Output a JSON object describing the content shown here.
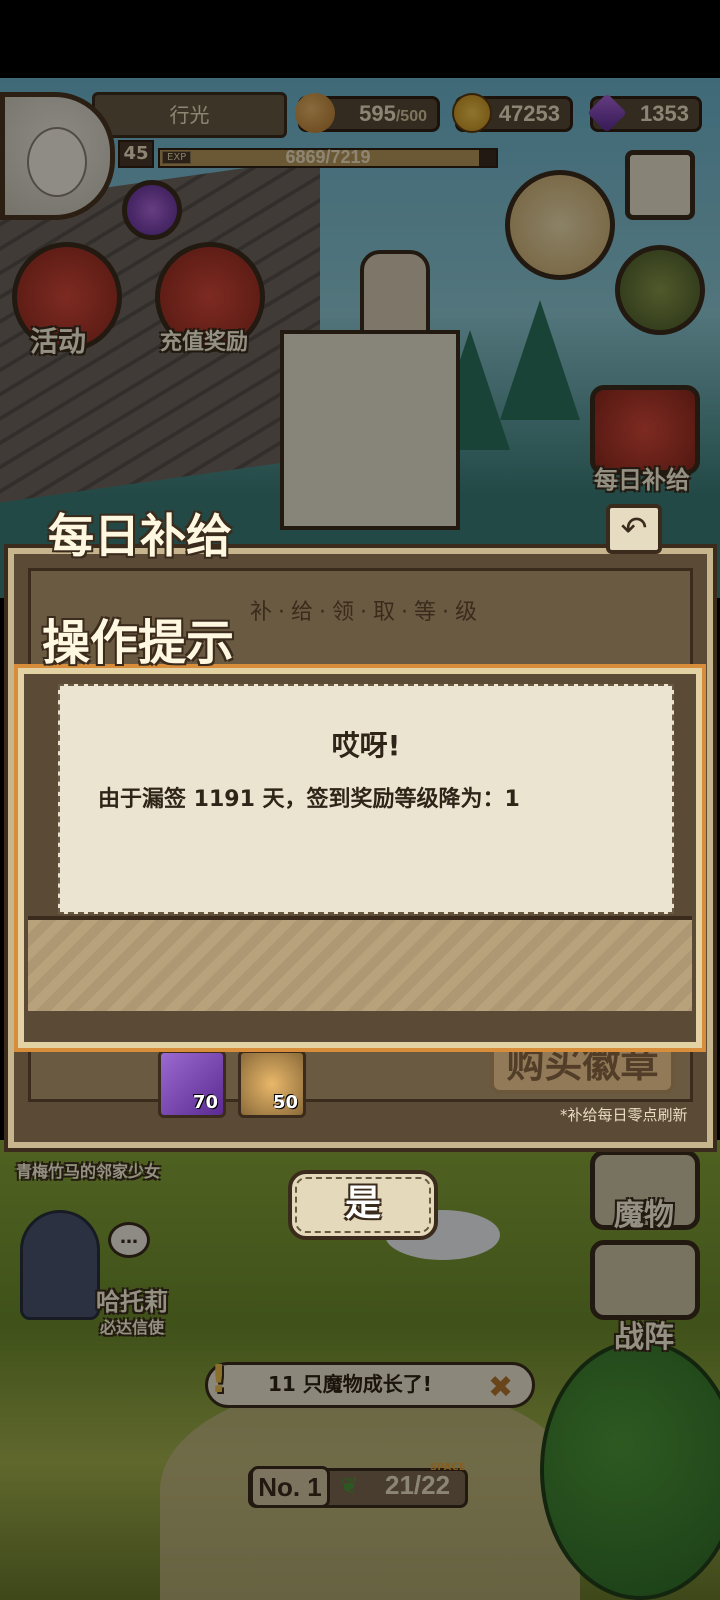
{
  "player": {
    "name": "行光",
    "level": "45",
    "exp_tag": "EXP",
    "exp_text": "6869/7219",
    "exp_fraction": 0.95
  },
  "resources": {
    "stamina": {
      "value": "595",
      "max": "/500",
      "icon": "bread-icon"
    },
    "gold": {
      "value": "47253",
      "icon": "gold-coin-icon"
    },
    "gems": {
      "value": "1353",
      "icon": "purple-gem-icon"
    }
  },
  "menu": {
    "events": "活动",
    "recharge_reward": "充值奖励",
    "daily_supply": "每日补给"
  },
  "daily_panel": {
    "title": "每日补给",
    "tier_label": "补·给·领·取·等·级",
    "items": [
      {
        "count": "70",
        "icon": "purple-gem-icon"
      },
      {
        "count": "50",
        "icon": "bread-icon"
      }
    ],
    "buy_badge": "购买徽章",
    "refresh_note": "*补给每日零点刷新"
  },
  "dialog": {
    "title": "操作提示",
    "heading": "哎呀!",
    "message": "由于漏签 1191 天，签到奖励等级降为：1",
    "confirm": "是"
  },
  "scene": {
    "npc_caption": "青梅竹马的邻家少女",
    "npc_name": "哈托莉",
    "npc_role": "必达信使",
    "bubble": "…",
    "notice": "11 只魔物成长了!",
    "monster_button": "魔物",
    "formation_button": "战阵",
    "rank_no": "No. 1",
    "capacity": "21/22",
    "space_tag": "SPACE"
  },
  "colors": {
    "accent_orange": "#d78d3a",
    "panel_brown": "#5a4a36",
    "paper": "#ebe4d0"
  }
}
